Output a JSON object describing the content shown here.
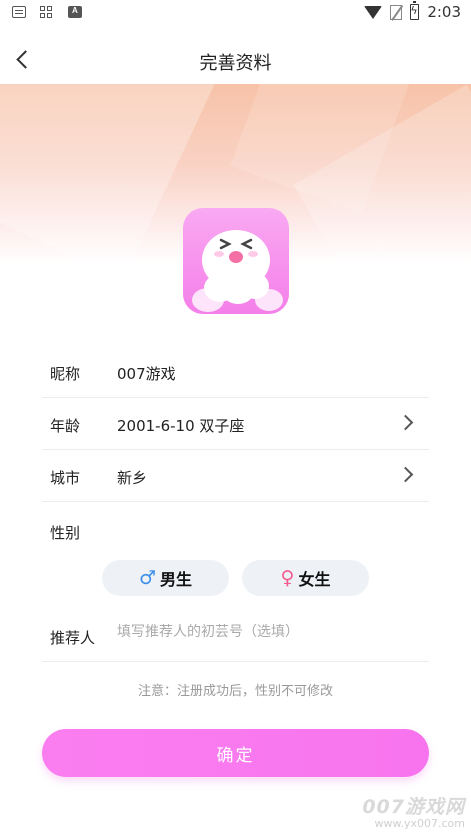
{
  "status_bar": {
    "time": "2:03"
  },
  "nav": {
    "title": "完善资料"
  },
  "form": {
    "nickname": {
      "label": "昵称",
      "value": "007游戏"
    },
    "age": {
      "label": "年龄",
      "value": "2001-6-10 双子座"
    },
    "city": {
      "label": "城市",
      "value": "新乡"
    },
    "gender": {
      "label": "性别",
      "male_symbol": "♂",
      "male_label": "男生",
      "female_symbol": "♀",
      "female_label": "女生"
    },
    "referrer": {
      "label": "推荐人",
      "value": "",
      "placeholder": "填写推荐人的初芸号（选填）"
    }
  },
  "notice": "注意：注册成功后，性别不可修改",
  "confirm_label": "确定",
  "watermark": {
    "main": "007游戏网",
    "url": "www.yx007.com"
  },
  "colors": {
    "accent": "#f87bef",
    "male": "#3b8de8",
    "female": "#f15b8e",
    "banner": "#f7c3a8"
  },
  "icons": [
    "keyboard-icon",
    "grid-icon",
    "font-icon",
    "wifi-icon",
    "no-sim-icon",
    "battery-icon",
    "back-arrow-icon",
    "chevron-right-icon",
    "app-mascot-icon"
  ]
}
